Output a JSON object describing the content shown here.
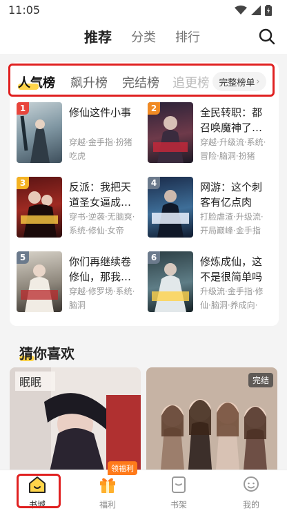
{
  "status_bar": {
    "time": "11:05"
  },
  "top_nav": {
    "tabs": [
      {
        "label": "推荐",
        "active": true
      },
      {
        "label": "分类",
        "active": false
      },
      {
        "label": "排行",
        "active": false
      }
    ],
    "search_icon": "search-icon"
  },
  "rank_tabs": {
    "tabs": [
      "人气榜",
      "飙升榜",
      "完结榜",
      "追更榜"
    ],
    "active_index": 0,
    "full_list_label": "完整榜单"
  },
  "ranked_books": [
    {
      "rank": "1",
      "title": "修仙这件小事",
      "tags": "穿越·金手指·扮猪吃虎",
      "badge_color": "#e8453c"
    },
    {
      "rank": "2",
      "title": "全民转职：都召唤魔神了…",
      "tags": "穿越·升级流·系统·冒险·脑洞·扮猪",
      "badge_color": "#f08a24"
    },
    {
      "rank": "3",
      "title": "反派：我把天道圣女逼成…",
      "tags": "穿书·逆袭·无脑爽·系统·修仙·女帝",
      "badge_color": "#f5b323"
    },
    {
      "rank": "4",
      "title": "网游：这个刺客有亿点肉",
      "tags": "打脸虐渣·升级流·开局巅峰·金手指",
      "badge_color": "#6b7a8c"
    },
    {
      "rank": "5",
      "title": "你们再继续卷修仙，那我…",
      "tags": "穿越·修罗场·系统·脑洞",
      "badge_color": "#6b7a8c"
    },
    {
      "rank": "6",
      "title": "修炼成仙，这不是很简单吗",
      "tags": "升级流·金手指·修仙·脑洞·养成向·",
      "badge_color": "#6b7a8c"
    }
  ],
  "guess_section": {
    "title": "猜你喜欢",
    "cards": [
      {
        "cover_text": "眠眠",
        "status": ""
      },
      {
        "cover_text": "",
        "status": "完结"
      }
    ]
  },
  "bottom_nav": {
    "items": [
      {
        "label": "书城",
        "icon": "home-icon",
        "active": true
      },
      {
        "label": "福利",
        "icon": "gift-icon",
        "active": false
      },
      {
        "label": "书架",
        "icon": "bookshelf-icon",
        "active": false
      },
      {
        "label": "我的",
        "icon": "profile-icon",
        "active": false
      }
    ],
    "welfare_badge": "领福利"
  },
  "colors": {
    "accent_yellow": "#ffd54a",
    "highlight_red": "#e02020"
  }
}
